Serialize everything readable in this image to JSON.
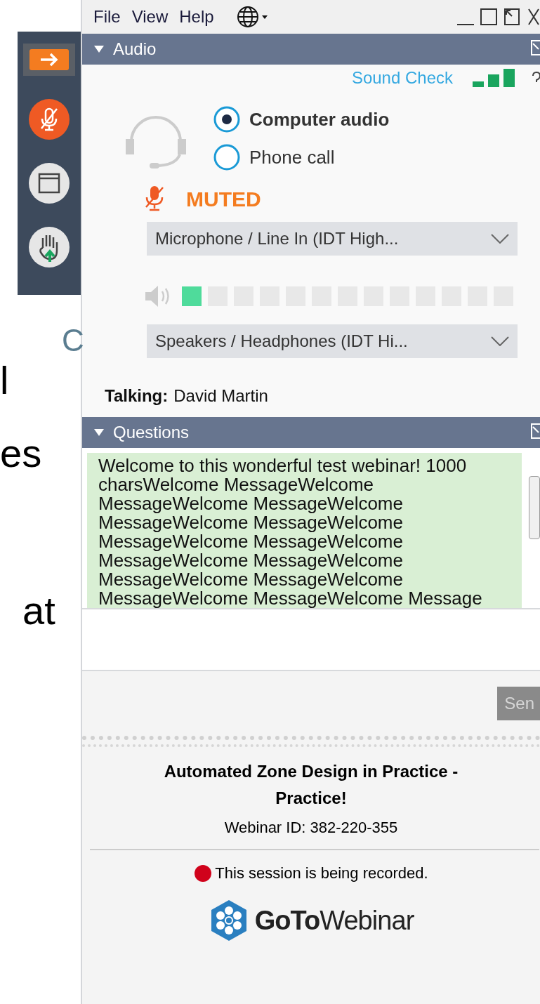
{
  "background_slide": {
    "fragments": [
      "C",
      "l",
      "es",
      "at"
    ]
  },
  "menu_bar": {
    "items": [
      "File",
      "View",
      "Help"
    ]
  },
  "toolbar": {
    "buttons": [
      {
        "kind": "expand"
      },
      {
        "kind": "mic",
        "muted": true
      },
      {
        "kind": "screen"
      },
      {
        "kind": "hand"
      }
    ]
  },
  "audio": {
    "title": "Audio",
    "expanded": true,
    "sound_check": "Sound Check",
    "options": [
      {
        "label": "Computer audio",
        "selected": true
      },
      {
        "label": "Phone call",
        "selected": false
      }
    ],
    "mic_status": "MUTED",
    "microphone": "Microphone / Line In (IDT High...",
    "speaker_level": {
      "level": 0.077
    },
    "speakers": "Speakers / Headphones (IDT Hi...",
    "talking_label": "Talking:",
    "talking_name": "David Martin"
  },
  "questions": {
    "title": "Questions",
    "expanded": true,
    "message": "Welcome to this wonderful test webinar! 1000 charsWelcome MessageWelcome MessageWelcome MessageWelcome MessageWelcome MessageWelcome MessageWelcome MessageWelcome MessageWelcome MessageWelcome MessageWelcome MessageWelcome MessageWelcome MessageWelcome Message",
    "send": "Sen"
  },
  "footer": {
    "title": "Automated Zone Design in Practice - Practice!",
    "webinar_id": "Webinar ID: 382-220-355",
    "recording": true,
    "recording_text": "This session is being recorded.",
    "logo_bold": "GoTo",
    "logo_light": "Webinar"
  }
}
